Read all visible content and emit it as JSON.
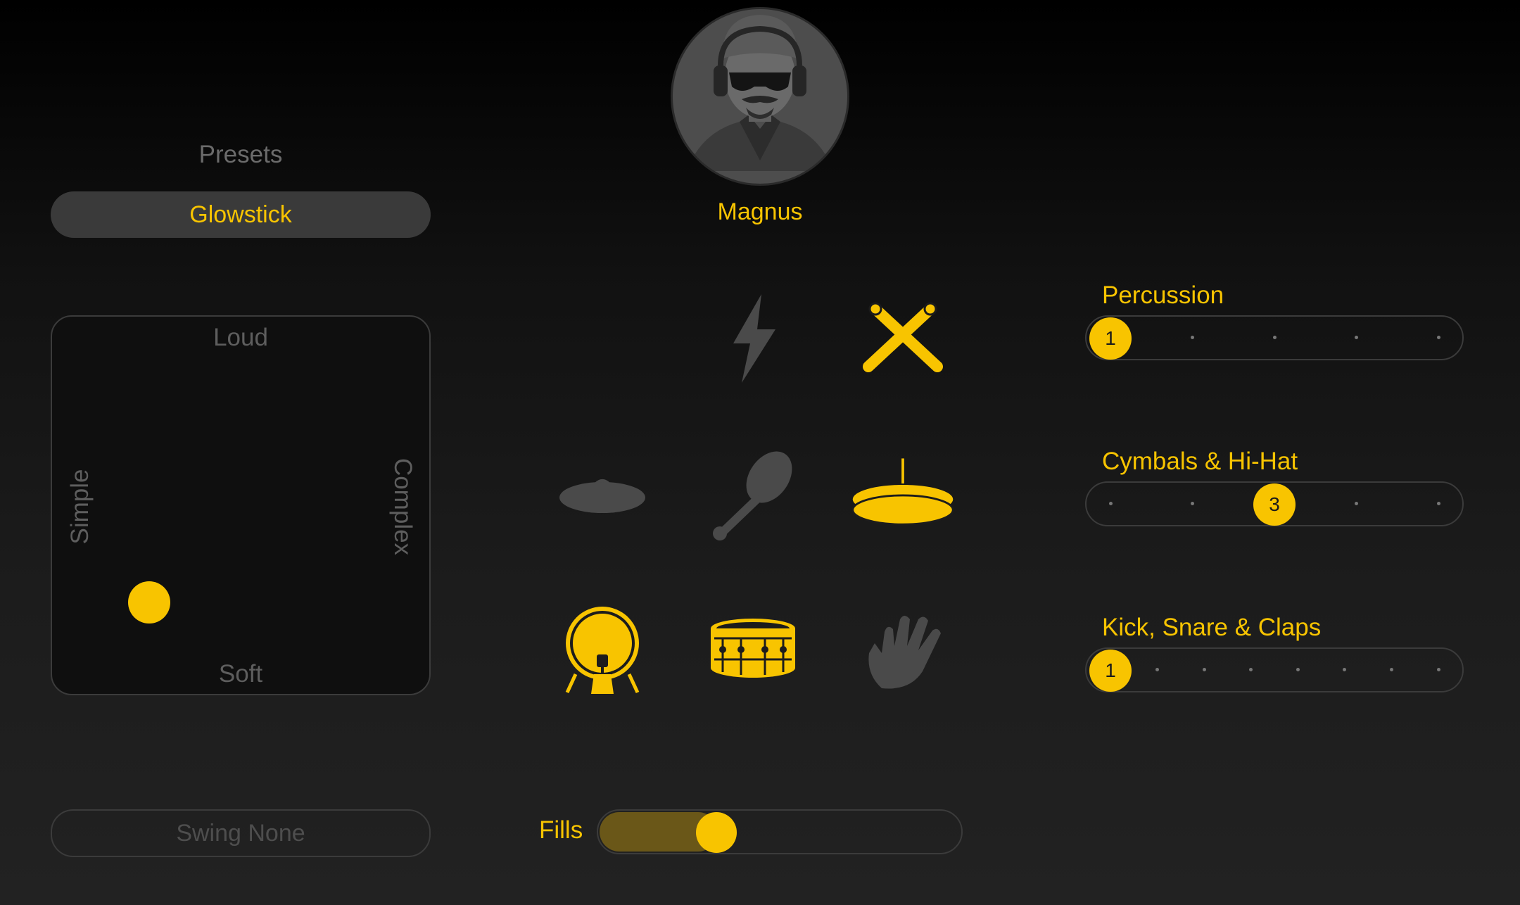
{
  "presets": {
    "label": "Presets",
    "selected": "Glowstick"
  },
  "xy_pad": {
    "top_label": "Loud",
    "bottom_label": "Soft",
    "left_label": "Simple",
    "right_label": "Complex"
  },
  "swing": {
    "label": "Swing None"
  },
  "drummer": {
    "name": "Magnus",
    "avatar_icon": "drummer-avatar"
  },
  "instruments": [
    {
      "name": "Lightning",
      "icon": "lightning-icon",
      "active": false
    },
    {
      "name": "Sticks",
      "icon": "crossed-sticks-icon",
      "active": true
    },
    {
      "name": "Cymbal",
      "icon": "crash-cymbal-icon",
      "active": false
    },
    {
      "name": "Shaker",
      "icon": "maraca-icon",
      "active": false
    },
    {
      "name": "Hi-Hat",
      "icon": "hihat-icon",
      "active": true
    },
    {
      "name": "Kick",
      "icon": "kick-drum-icon",
      "active": true
    },
    {
      "name": "Snare",
      "icon": "snare-drum-icon",
      "active": true
    },
    {
      "name": "Claps",
      "icon": "hand-clap-icon",
      "active": false
    }
  ],
  "fills": {
    "label": "Fills",
    "level": 0.2
  },
  "sliders": [
    {
      "label": "Percussion",
      "value": "1",
      "steps": 5,
      "position": 1
    },
    {
      "label": "Cymbals & Hi-Hat",
      "value": "3",
      "steps": 5,
      "position": 3
    },
    {
      "label": "Kick, Snare & Claps",
      "value": "1",
      "steps": 8,
      "position": 1
    }
  ],
  "colors": {
    "accent": "#f8c400",
    "inactive": "#4a4a4a",
    "border": "#3b3b3b"
  }
}
